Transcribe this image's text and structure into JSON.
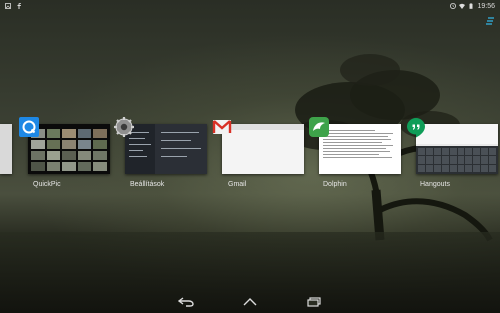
{
  "status_bar": {
    "time": "19:56",
    "left_icons": [
      "image-notification-icon",
      "facebook-notification-icon"
    ],
    "right_icons": [
      "alarm-icon",
      "wifi-icon",
      "battery-icon"
    ]
  },
  "recent_apps": [
    {
      "label": "QuickPic",
      "icon": "quickpic-icon",
      "accent": "#1e88e5"
    },
    {
      "label": "Beállítások",
      "icon": "settings-gear-icon",
      "accent": "#9e9e9e"
    },
    {
      "label": "Gmail",
      "icon": "gmail-icon",
      "accent": "#d93025"
    },
    {
      "label": "Dolphin",
      "icon": "dolphin-icon",
      "accent": "#3ea34a"
    },
    {
      "label": "Hangouts",
      "icon": "hangouts-icon",
      "accent": "#0f9d58"
    }
  ],
  "nav_bar": {
    "buttons": [
      "back-icon",
      "home-icon",
      "recents-icon"
    ]
  }
}
